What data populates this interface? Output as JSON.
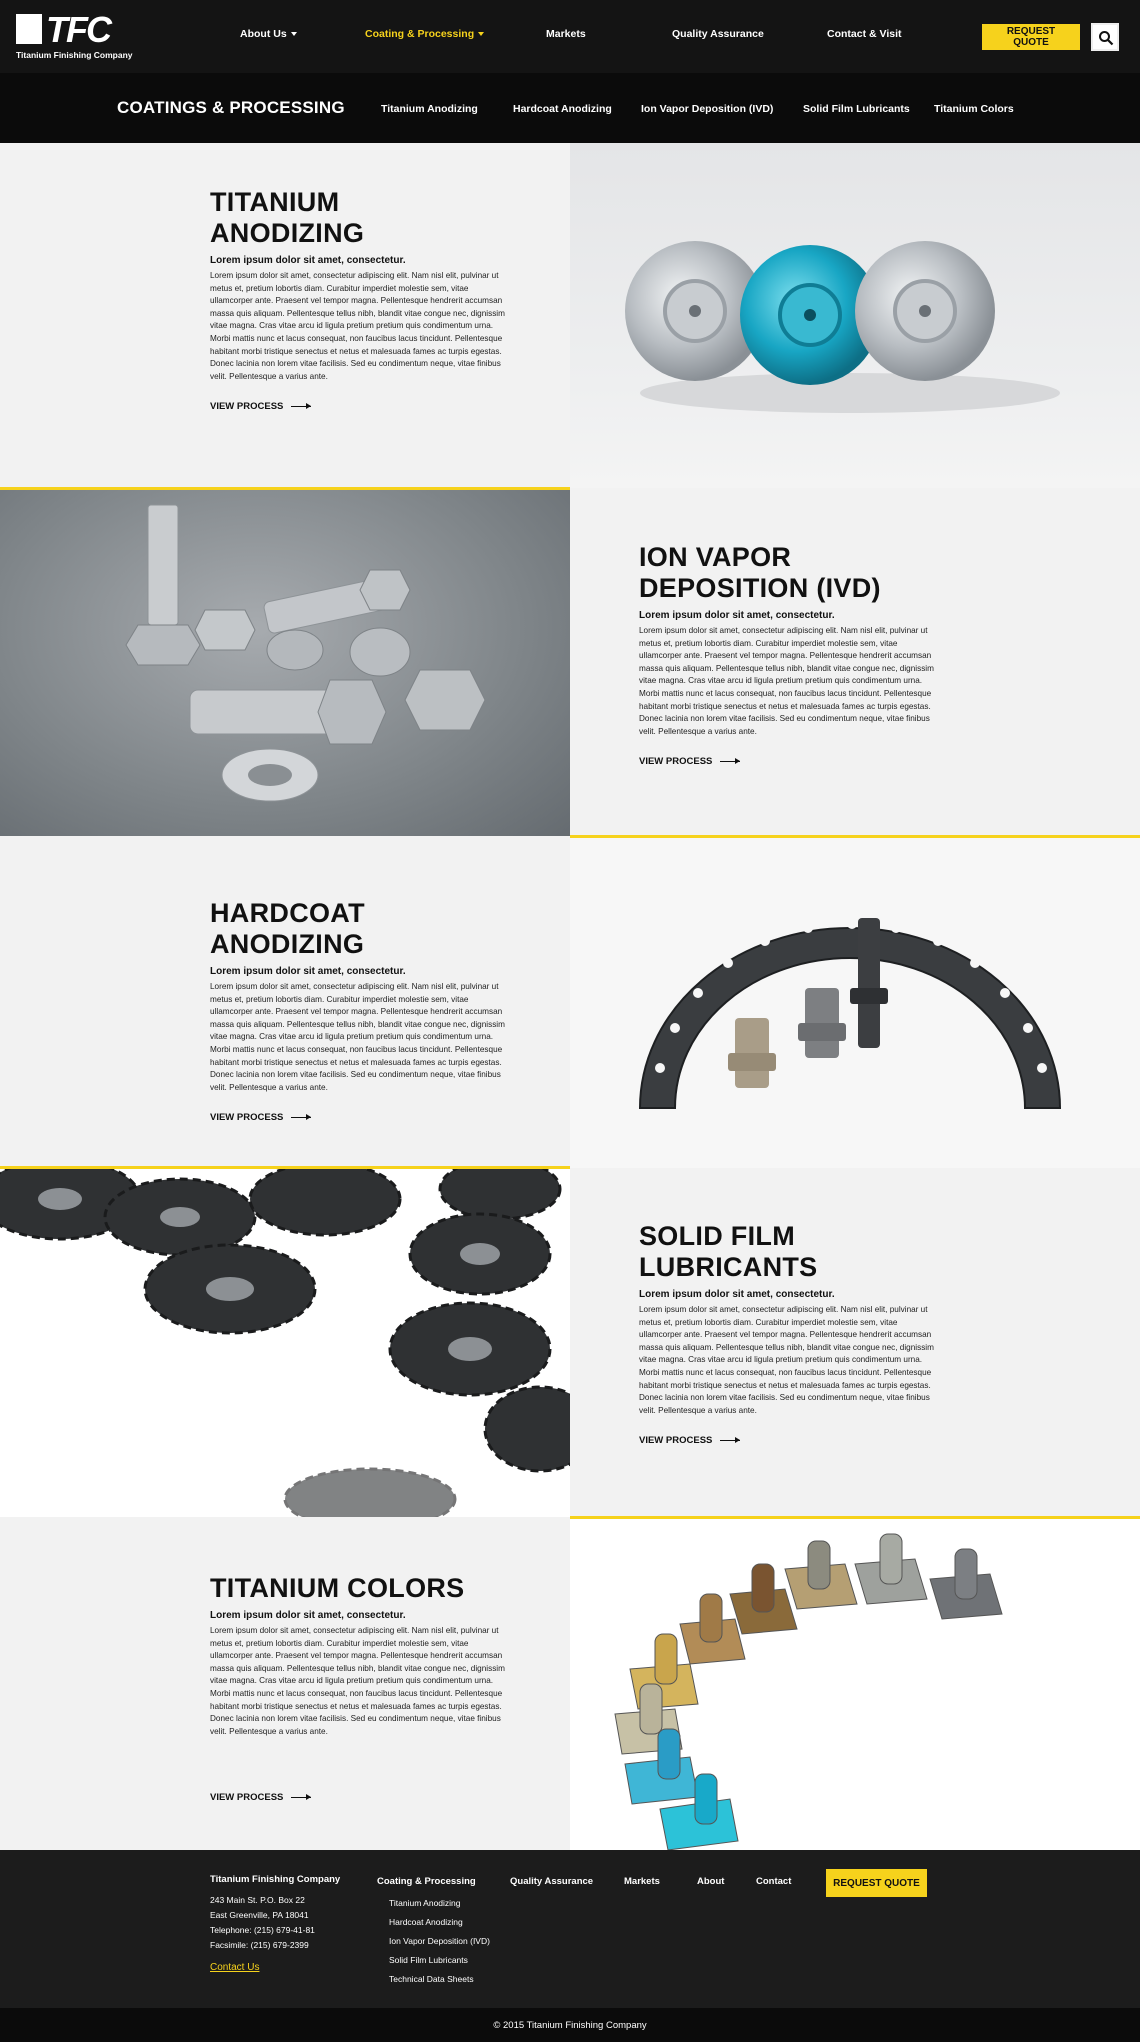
{
  "header": {
    "logo_text": "TFC",
    "logo_sub": "Titanium Finishing Company",
    "nav": [
      {
        "label": "About Us",
        "dropdown": true,
        "active": false
      },
      {
        "label": "Coating & Processing",
        "dropdown": true,
        "active": true
      },
      {
        "label": "Markets",
        "dropdown": false,
        "active": false
      },
      {
        "label": "Quality Assurance",
        "dropdown": false,
        "active": false
      },
      {
        "label": "Contact & Visit",
        "dropdown": false,
        "active": false
      }
    ],
    "quote_label": "REQUEST QUOTE",
    "search_icon": "search-icon"
  },
  "subnav": {
    "title": "COATINGS & PROCESSING",
    "items": [
      "Titanium Anodizing",
      "Hardcoat Anodizing",
      "Ion Vapor Deposition (IVD)",
      "Solid Film Lubricants",
      "Titanium Colors"
    ]
  },
  "sections": [
    {
      "title_line1": "TITANIUM",
      "title_line2": "ANODIZING",
      "lead": "Lorem ipsum dolor sit amet, consectetur.",
      "body": "Lorem ipsum dolor sit amet, consectetur adipiscing elit. Nam nisl elit, pulvinar ut metus et, pretium lobortis diam. Curabitur imperdiet molestie sem, vitae ullamcorper ante. Praesent vel tempor magna. Pellentesque hendrerit accumsan massa quis aliquam. Pellentesque tellus nibh, blandit vitae congue nec, dignissim vitae magna. Cras vitae arcu id ligula pretium pretium quis condimentum urna. Morbi mattis nunc et lacus consequat, non faucibus lacus tincidunt. Pellentesque habitant morbi tristique senectus et netus et malesuada fames ac turpis egestas. Donec lacinia non lorem vitae facilisis. Sed eu condimentum neque, vitae finibus velit. Pellentesque a varius ante.",
      "cta": "VIEW PROCESS"
    },
    {
      "title_line1": "ION VAPOR",
      "title_line2": "DEPOSITION (IVD)",
      "lead": "Lorem ipsum dolor sit amet, consectetur.",
      "body": "Lorem ipsum dolor sit amet, consectetur adipiscing elit. Nam nisl elit, pulvinar ut metus et, pretium lobortis diam. Curabitur imperdiet molestie sem, vitae ullamcorper ante. Praesent vel tempor magna. Pellentesque hendrerit accumsan massa quis aliquam. Pellentesque tellus nibh, blandit vitae congue nec, dignissim vitae magna. Cras vitae arcu id ligula pretium pretium quis condimentum urna. Morbi mattis nunc et lacus consequat, non faucibus lacus tincidunt. Pellentesque habitant morbi tristique senectus et netus et malesuada fames ac turpis egestas. Donec lacinia non lorem vitae facilisis. Sed eu condimentum neque, vitae finibus velit. Pellentesque a varius ante.",
      "cta": "VIEW PROCESS"
    },
    {
      "title_line1": "HARDCOAT",
      "title_line2": "ANODIZING",
      "lead": "Lorem ipsum dolor sit amet, consectetur.",
      "body": "Lorem ipsum dolor sit amet, consectetur adipiscing elit. Nam nisl elit, pulvinar ut metus et, pretium lobortis diam. Curabitur imperdiet molestie sem, vitae ullamcorper ante. Praesent vel tempor magna. Pellentesque hendrerit accumsan massa quis aliquam. Pellentesque tellus nibh, blandit vitae congue nec, dignissim vitae magna. Cras vitae arcu id ligula pretium pretium quis condimentum urna. Morbi mattis nunc et lacus consequat, non faucibus lacus tincidunt. Pellentesque habitant morbi tristique senectus et netus et malesuada fames ac turpis egestas. Donec lacinia non lorem vitae facilisis. Sed eu condimentum neque, vitae finibus velit. Pellentesque a varius ante.",
      "cta": "VIEW PROCESS"
    },
    {
      "title_line1": "SOLID FILM",
      "title_line2": "LUBRICANTS",
      "lead": "Lorem ipsum dolor sit amet, consectetur.",
      "body": "Lorem ipsum dolor sit amet, consectetur adipiscing elit. Nam nisl elit, pulvinar ut metus et, pretium lobortis diam. Curabitur imperdiet molestie sem, vitae ullamcorper ante. Praesent vel tempor magna. Pellentesque hendrerit accumsan massa quis aliquam. Pellentesque tellus nibh, blandit vitae congue nec, dignissim vitae magna. Cras vitae arcu id ligula pretium pretium quis condimentum urna. Morbi mattis nunc et lacus consequat, non faucibus lacus tincidunt. Pellentesque habitant morbi tristique senectus et netus et malesuada fames ac turpis egestas. Donec lacinia non lorem vitae facilisis. Sed eu condimentum neque, vitae finibus velit. Pellentesque a varius ante.",
      "cta": "VIEW PROCESS"
    },
    {
      "title_line1": "TITANIUM COLORS",
      "title_line2": "",
      "lead": "Lorem ipsum dolor sit amet, consectetur.",
      "body": "Lorem ipsum dolor sit amet, consectetur adipiscing elit. Nam nisl elit, pulvinar ut metus et, pretium lobortis diam. Curabitur imperdiet molestie sem, vitae ullamcorper ante. Praesent vel tempor magna. Pellentesque hendrerit accumsan massa quis aliquam. Pellentesque tellus nibh, blandit vitae congue nec, dignissim vitae magna. Cras vitae arcu id ligula pretium pretium quis condimentum urna. Morbi mattis nunc et lacus consequat, non faucibus lacus tincidunt. Pellentesque habitant morbi tristique senectus et netus et malesuada fames ac turpis egestas. Donec lacinia non lorem vitae facilisis. Sed eu condimentum neque, vitae finibus velit. Pellentesque a varius ante.",
      "cta": "VIEW PROCESS"
    }
  ],
  "footer": {
    "company": "Titanium Finishing Company",
    "address": [
      "243 Main St. P.O. Box 22",
      "East Greenville, PA 18041",
      "Telephone: (215) 679-41-81",
      "Facsimile: (215) 679-2399"
    ],
    "contact_link": "Contact Us",
    "coating_title": "Coating & Processing",
    "coating_items": [
      "Titanium Anodizing",
      "Hardcoat Anodizing",
      "Ion Vapor Deposition (IVD)",
      "Solid Film Lubricants",
      "Technical Data Sheets"
    ],
    "links": [
      "Quality Assurance",
      "Markets",
      "About",
      "Contact"
    ],
    "quote_label": "REQUEST QUOTE",
    "copyright": "© 2015 Titanium Finishing Company"
  },
  "colors": {
    "accent": "#f6d21c",
    "dark": "#141414",
    "panel": "#f2f2f2"
  }
}
